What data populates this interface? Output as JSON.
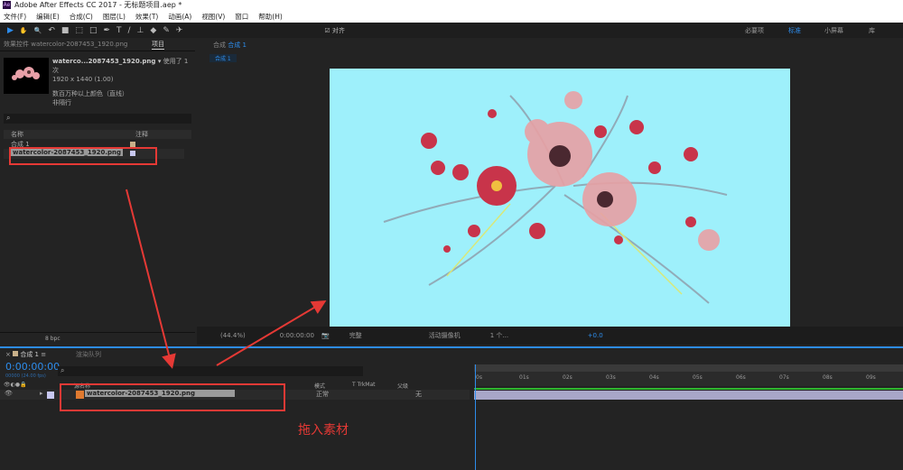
{
  "app": {
    "title": "Adobe After Effects CC 2017 - 无标题项目.aep *",
    "logo": "Ae"
  },
  "menu": [
    "文件(F)",
    "编辑(E)",
    "合成(C)",
    "图层(L)",
    "效果(T)",
    "动画(A)",
    "视图(V)",
    "窗口",
    "帮助(H)"
  ],
  "toolbar": {
    "tools": [
      "▶",
      "✋",
      "🔍",
      "↶",
      "■",
      "⬚",
      "□",
      "✒",
      "T",
      "/",
      "⊥",
      "◆",
      "✎",
      "✈"
    ],
    "snap_label": "对齐",
    "workspaces": [
      "必要项",
      "标准",
      "小屏幕",
      "库"
    ],
    "active_workspace": "标准"
  },
  "left_panel": {
    "effects_tab": "效果控件 watercolor-2087453_1920.png",
    "project_tab": "项目",
    "item_name": "waterco...2087453_1920.png ▾",
    "used": "使用了 1 次",
    "dims": "1920 x 1440 (1.00)",
    "color": "数百万种以上颜色（直线）",
    "interlace": "非隔行",
    "search_placeholder": "",
    "col_name": "名称",
    "col_comment": "注释",
    "items": [
      {
        "name": "合成 1",
        "color": "#c8b08a"
      },
      {
        "name": "watercolor-2087453_1920.png",
        "color": "#c8c8f0"
      }
    ],
    "bpc": "8 bpc"
  },
  "viewer": {
    "tab_prefix": "合成",
    "tab_name": "合成 1",
    "breadcrumb": "合成 1",
    "zoom": "(44.4%)",
    "timecode": "0:00:00:00",
    "quality": "完整",
    "camera": "活动摄像机",
    "views": "1 个...",
    "exposure": "+0.0",
    "bg_color": "#9ef0fb"
  },
  "timeline": {
    "tab": "合成 1",
    "render_tab": "渲染队列",
    "timecode": "0:00:00:00",
    "fps": "00000 (24.00 fps)",
    "col_source": "源名称",
    "col_mode": "模式",
    "col_trkmat": "T  TrkMat",
    "col_parent": "父级",
    "layer": {
      "num": "1",
      "name": "watercolor-2087453_1920.png",
      "mode": "正常",
      "parent": "无",
      "label_color": "#c8c8f0"
    },
    "ticks": [
      "0s",
      "01s",
      "02s",
      "03s",
      "04s",
      "05s",
      "06s",
      "07s",
      "08s",
      "09s"
    ]
  },
  "annotation": {
    "text": "拖入素材",
    "color": "#e53935"
  }
}
